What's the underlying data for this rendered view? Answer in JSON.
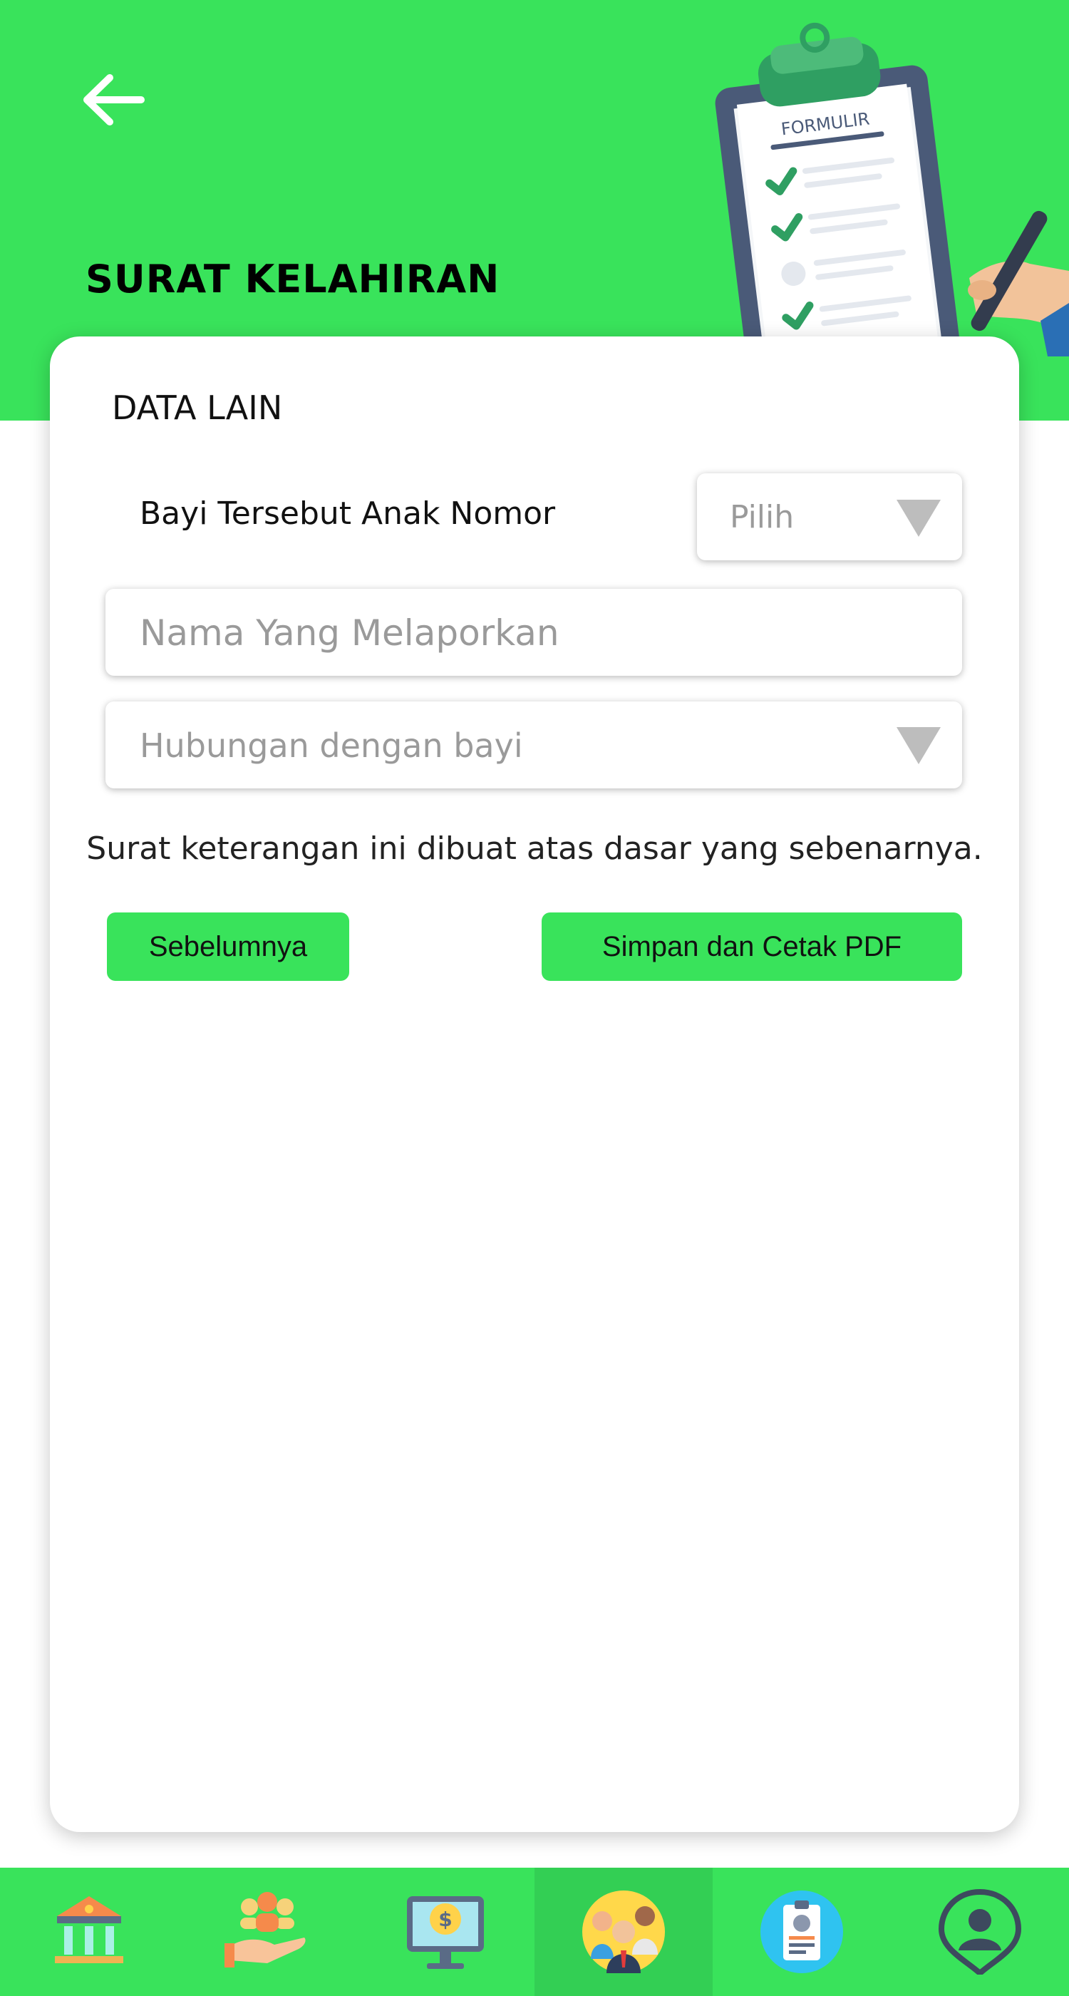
{
  "header": {
    "title": "SURAT KELAHIRAN",
    "back_icon": "arrow-left-icon",
    "illustration": {
      "icon": "clipboard-form-icon",
      "caption": "FORMULIR"
    },
    "background_color": "#39e35b"
  },
  "form": {
    "section_title": "DATA LAIN",
    "child_number": {
      "label": "Bayi Tersebut Anak Nomor",
      "placeholder": "Pilih"
    },
    "reporter_name": {
      "placeholder": "Nama Yang Melaporkan"
    },
    "relationship": {
      "placeholder": "Hubungan dengan bayi"
    },
    "statement": "Surat keterangan ini dibuat atas dasar yang sebenarnya.",
    "buttons": {
      "previous": "Sebelumnya",
      "save_print": "Simpan dan Cetak PDF"
    }
  },
  "bottom_nav": {
    "items": [
      {
        "icon": "government-building-icon",
        "active": false
      },
      {
        "icon": "community-hand-icon",
        "active": false
      },
      {
        "icon": "finance-monitor-icon",
        "active": false
      },
      {
        "icon": "people-group-icon",
        "active": true
      },
      {
        "icon": "id-card-icon",
        "active": false
      },
      {
        "icon": "location-person-icon",
        "active": false
      }
    ]
  },
  "colors": {
    "accent": "#39e35b",
    "accent_active": "#33cf54",
    "placeholder": "#9a9a9a"
  }
}
